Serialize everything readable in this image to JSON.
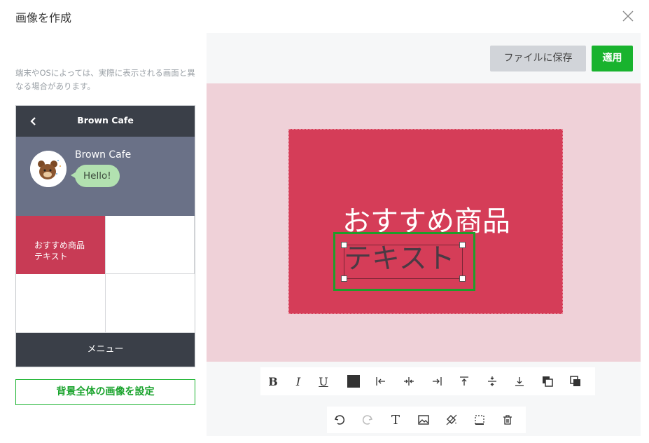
{
  "dialog": {
    "title": "画像を作成"
  },
  "preview": {
    "notice": "端末やOSによっては、実際に表示される画面と異なる場合があります。",
    "chat_title": "Brown Cafe",
    "sender_name": "Brown Cafe",
    "message": "Hello!",
    "richmenu_cell_text": "おすすめ商品\nテキスト",
    "menu_label": "メニュー"
  },
  "buttons": {
    "set_background": "背景全体の画像を設定",
    "save_file": "ファイルに保存",
    "apply": "適用"
  },
  "canvas": {
    "main_text": "おすすめ商品",
    "selected_text": "テキスト",
    "image_color": "#d53d58",
    "background_color": "#efd1d8",
    "selection_color": "#1f9d2a"
  },
  "toolbar": {
    "bold": "B",
    "italic": "I",
    "underline": "U",
    "text_tool": "T"
  },
  "colors": {
    "accent_green": "#19b32e",
    "header_dark": "#3a3f48",
    "chat_bg": "#6a7187"
  }
}
